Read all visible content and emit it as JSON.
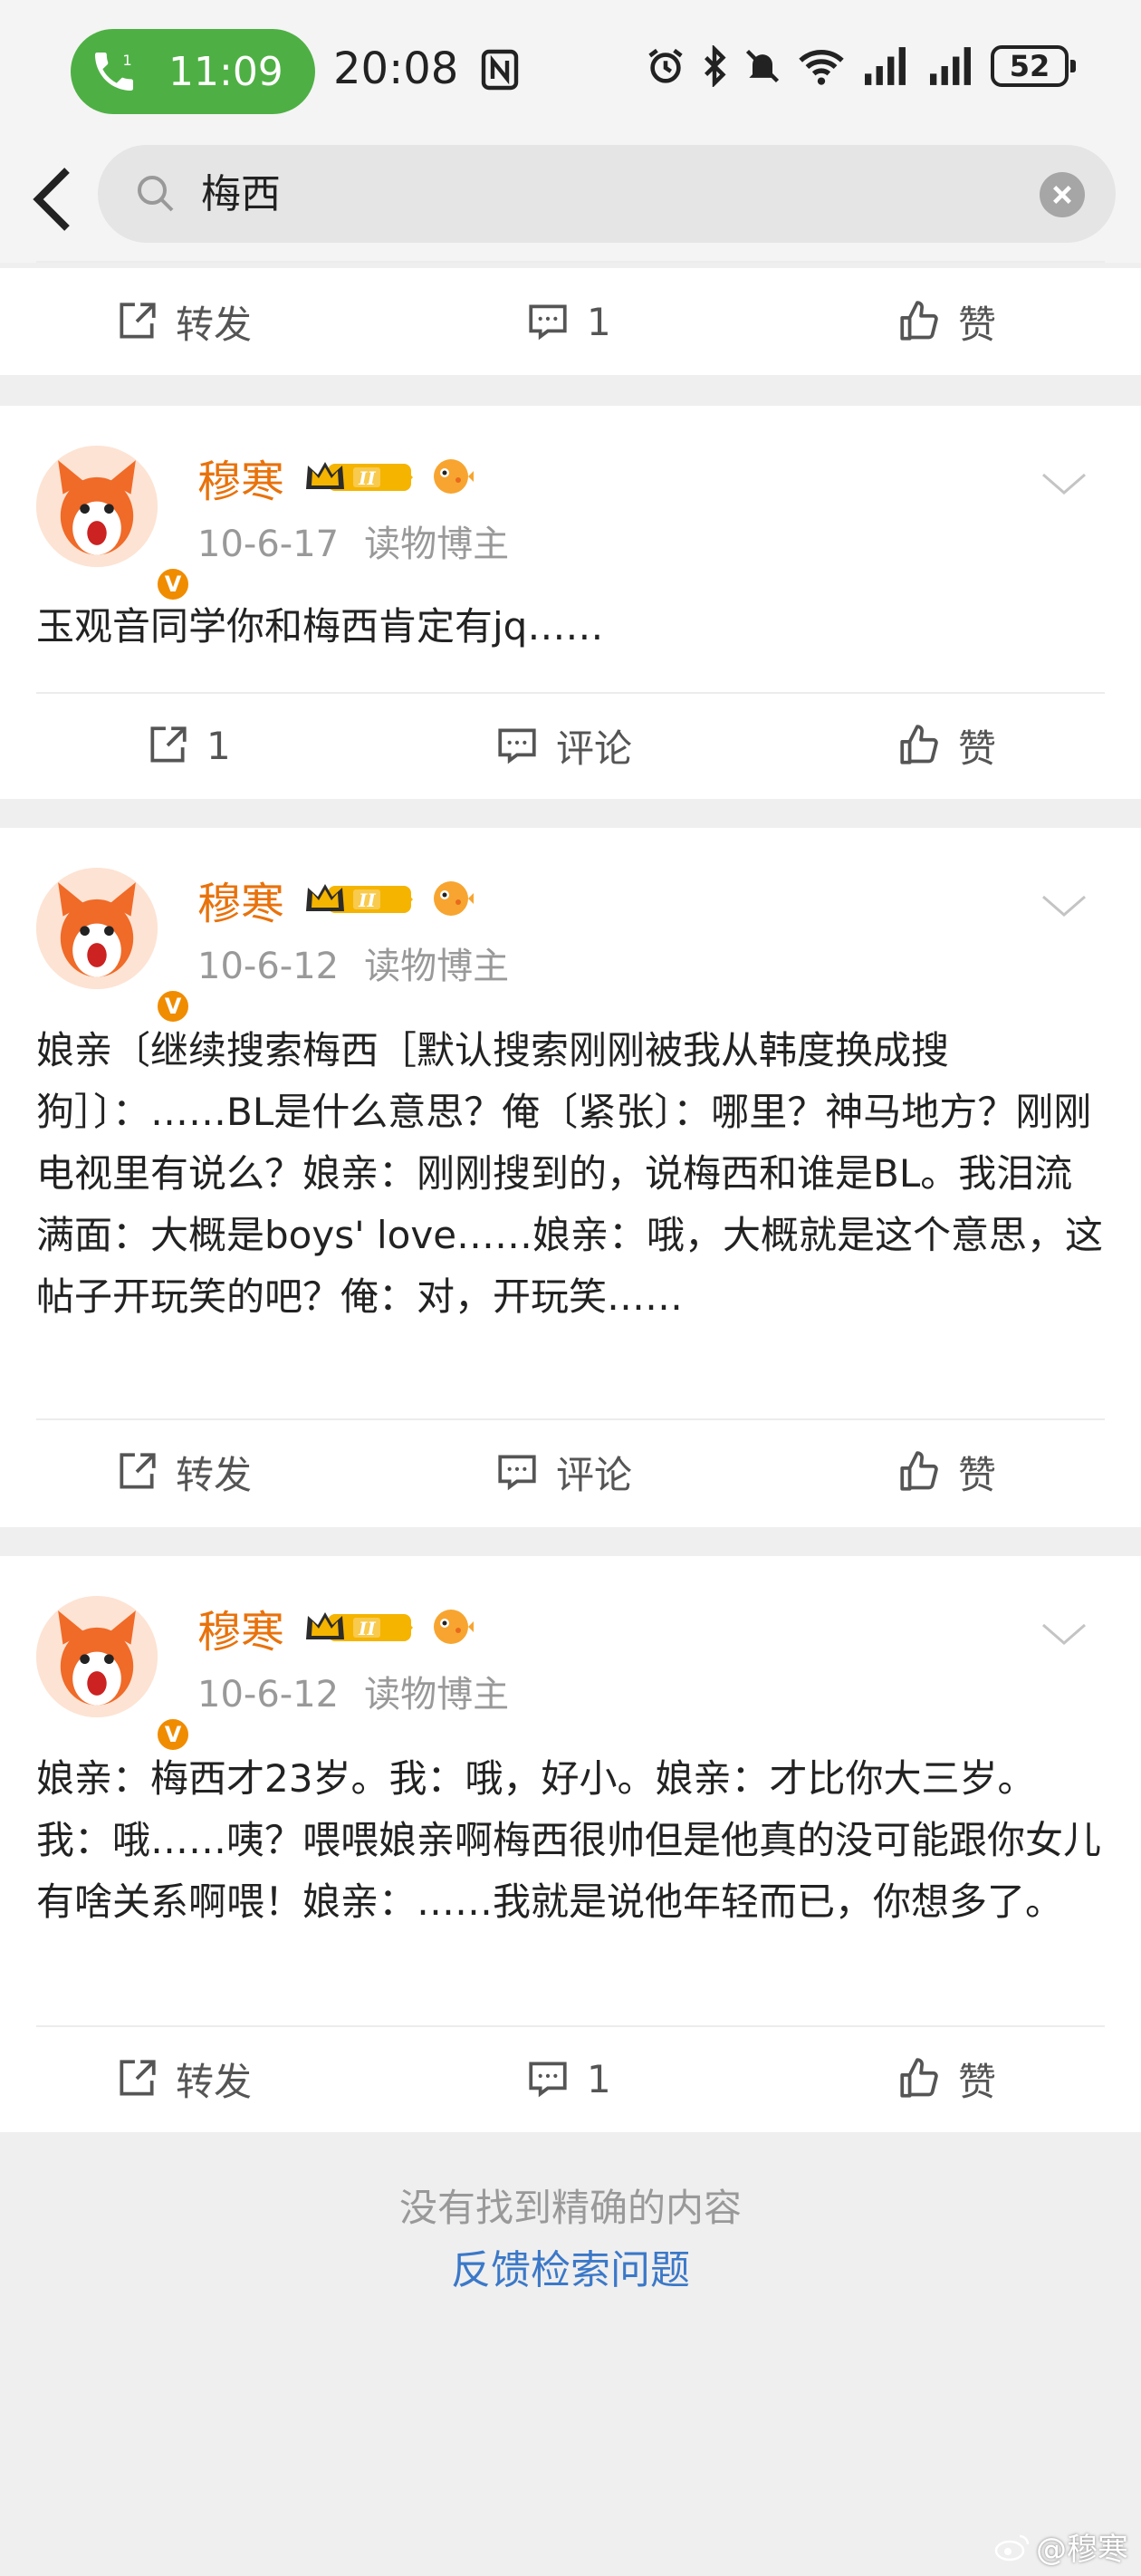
{
  "status_bar": {
    "call_time": "11:09",
    "clock": "20:08",
    "battery": "52"
  },
  "search": {
    "query": "梅西"
  },
  "labels": {
    "repost": "转发",
    "comment": "评论",
    "like": "赞"
  },
  "top_bar": {
    "repost": "转发",
    "comment_count": "1",
    "like": "赞"
  },
  "posts": [
    {
      "user": "穆寒",
      "date": "10-6-17",
      "role": "读物博主",
      "text": "玉观音同学你和梅西肯定有jq……",
      "repost": "1",
      "comment": "评论",
      "like": "赞"
    },
    {
      "user": "穆寒",
      "date": "10-6-12",
      "role": "读物博主",
      "text": "娘亲〔继续搜索梅西［默认搜索刚刚被我从韩度换成搜狗］〕：……BL是什么意思？俺〔紧张〕：哪里？神马地方？刚刚电视里有说么？娘亲：刚刚搜到的，说梅西和谁是BL。我泪流满面：大概是boys' love……娘亲：哦，大概就是这个意思，这帖子开玩笑的吧？俺：对，开玩笑……",
      "repost": "转发",
      "comment": "评论",
      "like": "赞"
    },
    {
      "user": "穆寒",
      "date": "10-6-12",
      "role": "读物博主",
      "text": "娘亲：梅西才23岁。我：哦，好小。娘亲：才比你大三岁。我：哦……咦？喂喂娘亲啊梅西很帅但是他真的没可能跟你女儿有啥关系啊喂！娘亲：……我就是说他年轻而已，你想多了。",
      "repost": "转发",
      "comment": "1",
      "like": "赞"
    }
  ],
  "footer": {
    "no_result": "没有找到精确的内容",
    "feedback": "反馈检索问题"
  },
  "watermark": "@穆寒",
  "colors": {
    "accent_orange": "#e8720c",
    "link_blue": "#3b78c8",
    "call_green": "#4eb044"
  }
}
